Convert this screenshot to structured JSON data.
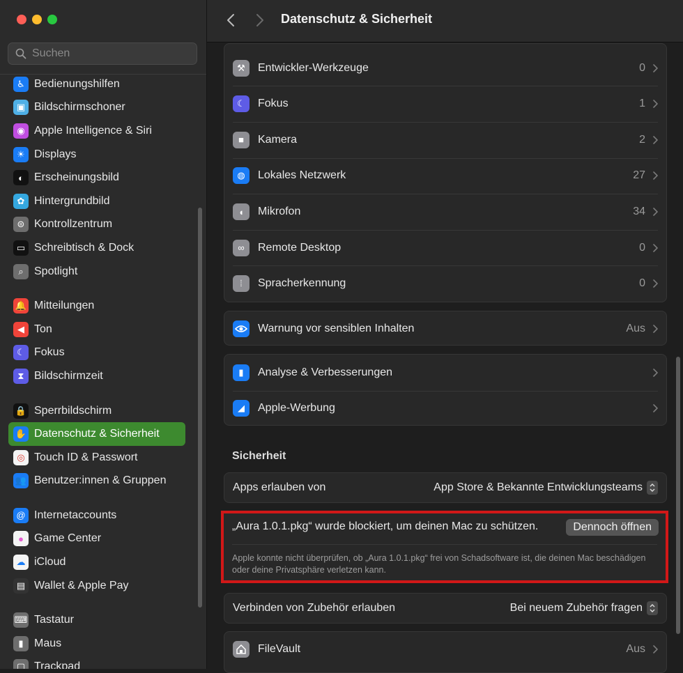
{
  "window": {
    "title": "Datenschutz & Sicherheit"
  },
  "search": {
    "placeholder": "Suchen"
  },
  "sidebar": {
    "groups": [
      [
        {
          "label": "Bedienungshilfen",
          "icon": "accessibility-icon",
          "color": "#1a7cf5"
        },
        {
          "label": "Bildschirmschoner",
          "icon": "screensaver-icon",
          "color": "#4fb0e6"
        },
        {
          "label": "Apple Intelligence & Siri",
          "icon": "siri-icon",
          "color": "#c04ee0"
        },
        {
          "label": "Displays",
          "icon": "sun-icon",
          "color": "#1a7cf5"
        },
        {
          "label": "Erscheinungsbild",
          "icon": "appearance-icon",
          "color": "#111111"
        },
        {
          "label": "Hintergrundbild",
          "icon": "flower-icon",
          "color": "#35a8e0"
        },
        {
          "label": "Kontrollzentrum",
          "icon": "toggles-icon",
          "color": "#6e6e6e"
        },
        {
          "label": "Schreibtisch & Dock",
          "icon": "dock-icon",
          "color": "#111111"
        },
        {
          "label": "Spotlight",
          "icon": "magnifier-icon",
          "color": "#6e6e6e"
        }
      ],
      [
        {
          "label": "Mitteilungen",
          "icon": "bell-icon",
          "color": "#f0443a"
        },
        {
          "label": "Ton",
          "icon": "speaker-icon",
          "color": "#f0443a"
        },
        {
          "label": "Fokus",
          "icon": "moon-icon",
          "color": "#5e5ce6"
        },
        {
          "label": "Bildschirmzeit",
          "icon": "hourglass-icon",
          "color": "#5e5ce6"
        }
      ],
      [
        {
          "label": "Sperrbildschirm",
          "icon": "lock-icon",
          "color": "#111111"
        },
        {
          "label": "Datenschutz & Sicherheit",
          "icon": "hand-icon",
          "color": "#1a7cf5",
          "active": true
        },
        {
          "label": "Touch ID & Passwort",
          "icon": "fingerprint-icon",
          "color": "#f4f4f4"
        },
        {
          "label": "Benutzer:innen & Gruppen",
          "icon": "users-icon",
          "color": "#1a7cf5"
        }
      ],
      [
        {
          "label": "Internetaccounts",
          "icon": "at-icon",
          "color": "#1a7cf5"
        },
        {
          "label": "Game Center",
          "icon": "gamecenter-icon",
          "color": "#f4f4f4"
        },
        {
          "label": "iCloud",
          "icon": "cloud-icon",
          "color": "#f4f4f4"
        },
        {
          "label": "Wallet & Apple Pay",
          "icon": "wallet-icon",
          "color": "#333333"
        }
      ],
      [
        {
          "label": "Tastatur",
          "icon": "keyboard-icon",
          "color": "#6e6e6e"
        },
        {
          "label": "Maus",
          "icon": "mouse-icon",
          "color": "#6e6e6e"
        },
        {
          "label": "Trackpad",
          "icon": "trackpad-icon",
          "color": "#6e6e6e"
        }
      ]
    ]
  },
  "permissions": [
    {
      "label": "Entwickler-Werkzeuge",
      "value": "0",
      "icon": "hammer-icon",
      "color": "#8e8e93"
    },
    {
      "label": "Fokus",
      "value": "1",
      "icon": "moon-icon",
      "color": "#5e5ce6"
    },
    {
      "label": "Kamera",
      "value": "2",
      "icon": "camera-icon",
      "color": "#8e8e93"
    },
    {
      "label": "Lokales Netzwerk",
      "value": "27",
      "icon": "globe-icon",
      "color": "#1a7cf5"
    },
    {
      "label": "Mikrofon",
      "value": "34",
      "icon": "microphone-icon",
      "color": "#8e8e93"
    },
    {
      "label": "Remote Desktop",
      "value": "0",
      "icon": "binoculars-icon",
      "color": "#8e8e93"
    },
    {
      "label": "Spracherkennung",
      "value": "0",
      "icon": "waveform-icon",
      "color": "#8e8e93"
    }
  ],
  "sensitive": {
    "label": "Warnung vor sensiblen Inhalten",
    "value": "Aus",
    "icon": "eye-warning-icon",
    "color": "#1a7cf5"
  },
  "analytics": [
    {
      "label": "Analyse & Verbesserungen",
      "icon": "chart-icon",
      "color": "#1a7cf5"
    },
    {
      "label": "Apple-Werbung",
      "icon": "megaphone-icon",
      "color": "#1a7cf5"
    }
  ],
  "security": {
    "title": "Sicherheit",
    "apps_label": "Apps erlauben von",
    "apps_value": "App Store & Bekannte Entwicklungsteams",
    "blocked_message": "„Aura 1.0.1.pkg“ wurde blockiert, um deinen Mac zu schützen.",
    "open_anyway": "Dennoch öffnen",
    "blocked_note": "Apple konnte nicht überprüfen, ob „Aura 1.0.1.pkg“ frei von Schadsoftware ist, die deinen Mac beschädigen oder deine Privatsphäre verletzen kann.",
    "accessory_label": "Verbinden von Zubehör erlauben",
    "accessory_value": "Bei neuem Zubehör fragen",
    "filevault_label": "FileVault",
    "filevault_value": "Aus"
  }
}
